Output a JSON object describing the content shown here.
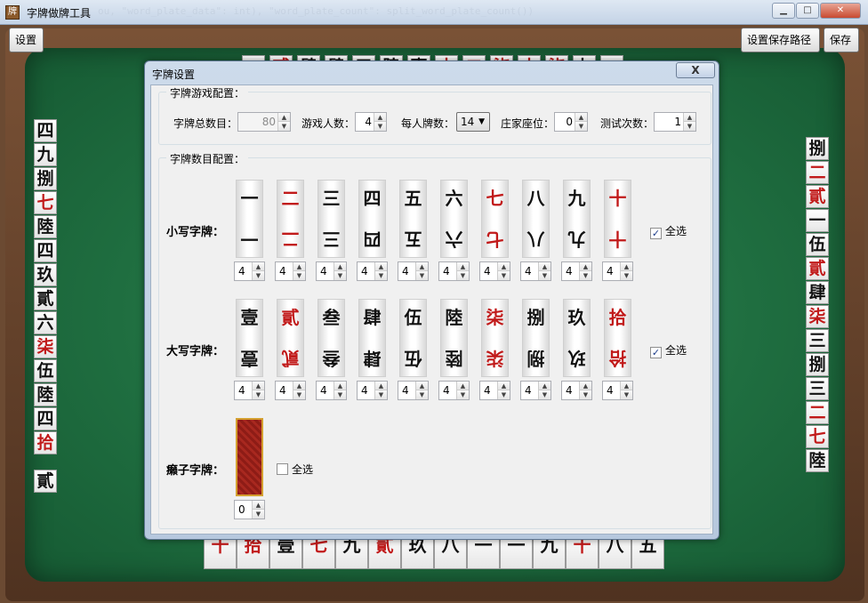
{
  "window": {
    "title": "字牌做牌工具",
    "title_code": "ou, \"word_plate_data\": int), \"word_plate_count\": split_word_plate_count())",
    "min_icon": "minimize-icon",
    "max_icon": "maximize-icon",
    "close_icon": "close-icon"
  },
  "toolbar": {
    "settings_label": "设置",
    "save_path_label": "设置保存路径",
    "save_label": "保存"
  },
  "left_column": [
    "四",
    "九",
    "捌",
    "七",
    "陸",
    "四",
    "玖",
    "貳",
    "六",
    "柒",
    "伍",
    "陸",
    "四",
    "拾",
    "貳"
  ],
  "left_column_red": [
    false,
    false,
    false,
    true,
    false,
    false,
    false,
    false,
    false,
    true,
    false,
    false,
    false,
    true,
    false
  ],
  "right_column": [
    "捌",
    "二",
    "貳",
    "一",
    "伍",
    "貳",
    "肆",
    "柒",
    "三",
    "捌",
    "三",
    "二",
    "七",
    "陸"
  ],
  "right_column_red": [
    false,
    true,
    true,
    false,
    false,
    true,
    false,
    true,
    false,
    false,
    false,
    true,
    true,
    false
  ],
  "top_row": [
    "一",
    "貳",
    "肆",
    "肆",
    "五",
    "陸",
    "壹",
    "十",
    "二",
    "柒",
    "十",
    "柒",
    "九",
    "一"
  ],
  "top_row_red": [
    false,
    true,
    false,
    false,
    false,
    false,
    false,
    true,
    true,
    true,
    true,
    true,
    false,
    false
  ],
  "bottom_row": [
    "十",
    "拾",
    "壹",
    "七",
    "九",
    "貳",
    "玖",
    "八",
    "一",
    "一",
    "九",
    "十",
    "八",
    "五"
  ],
  "bottom_row_red": [
    true,
    true,
    false,
    true,
    false,
    true,
    false,
    false,
    false,
    false,
    false,
    true,
    false,
    false
  ],
  "dialog": {
    "title": "字牌设置",
    "close_label": "X",
    "game_group_label": "字牌游戏配置：",
    "count_group_label": "字牌数目配置：",
    "total_label": "字牌总数目：",
    "total_value": "80",
    "players_label": "游戏人数：",
    "players_value": "4",
    "per_player_label": "每人牌数：",
    "per_player_value": "14",
    "dealer_label": "庄家座位：",
    "dealer_value": "0",
    "test_label": "测试次数：",
    "test_value": "1",
    "small_label": "小写字牌：",
    "big_label": "大写字牌：",
    "wild_label": "癞子字牌：",
    "select_all_label": "全选",
    "small_select_all": true,
    "big_select_all": true,
    "wild_select_all": false,
    "small_tiles": [
      {
        "char": "一",
        "red": false,
        "count": "4"
      },
      {
        "char": "二",
        "red": true,
        "count": "4"
      },
      {
        "char": "三",
        "red": false,
        "count": "4"
      },
      {
        "char": "四",
        "red": false,
        "count": "4"
      },
      {
        "char": "五",
        "red": false,
        "count": "4"
      },
      {
        "char": "六",
        "red": false,
        "count": "4"
      },
      {
        "char": "七",
        "red": true,
        "count": "4"
      },
      {
        "char": "八",
        "red": false,
        "count": "4"
      },
      {
        "char": "九",
        "red": false,
        "count": "4"
      },
      {
        "char": "十",
        "red": true,
        "count": "4"
      }
    ],
    "big_tiles": [
      {
        "char": "壹",
        "red": false,
        "count": "4"
      },
      {
        "char": "貳",
        "red": true,
        "count": "4"
      },
      {
        "char": "叁",
        "red": false,
        "count": "4"
      },
      {
        "char": "肆",
        "red": false,
        "count": "4"
      },
      {
        "char": "伍",
        "red": false,
        "count": "4"
      },
      {
        "char": "陸",
        "red": false,
        "count": "4"
      },
      {
        "char": "柒",
        "red": true,
        "count": "4"
      },
      {
        "char": "捌",
        "red": false,
        "count": "4"
      },
      {
        "char": "玖",
        "red": false,
        "count": "4"
      },
      {
        "char": "拾",
        "red": true,
        "count": "4"
      }
    ],
    "wild_count": "0"
  }
}
